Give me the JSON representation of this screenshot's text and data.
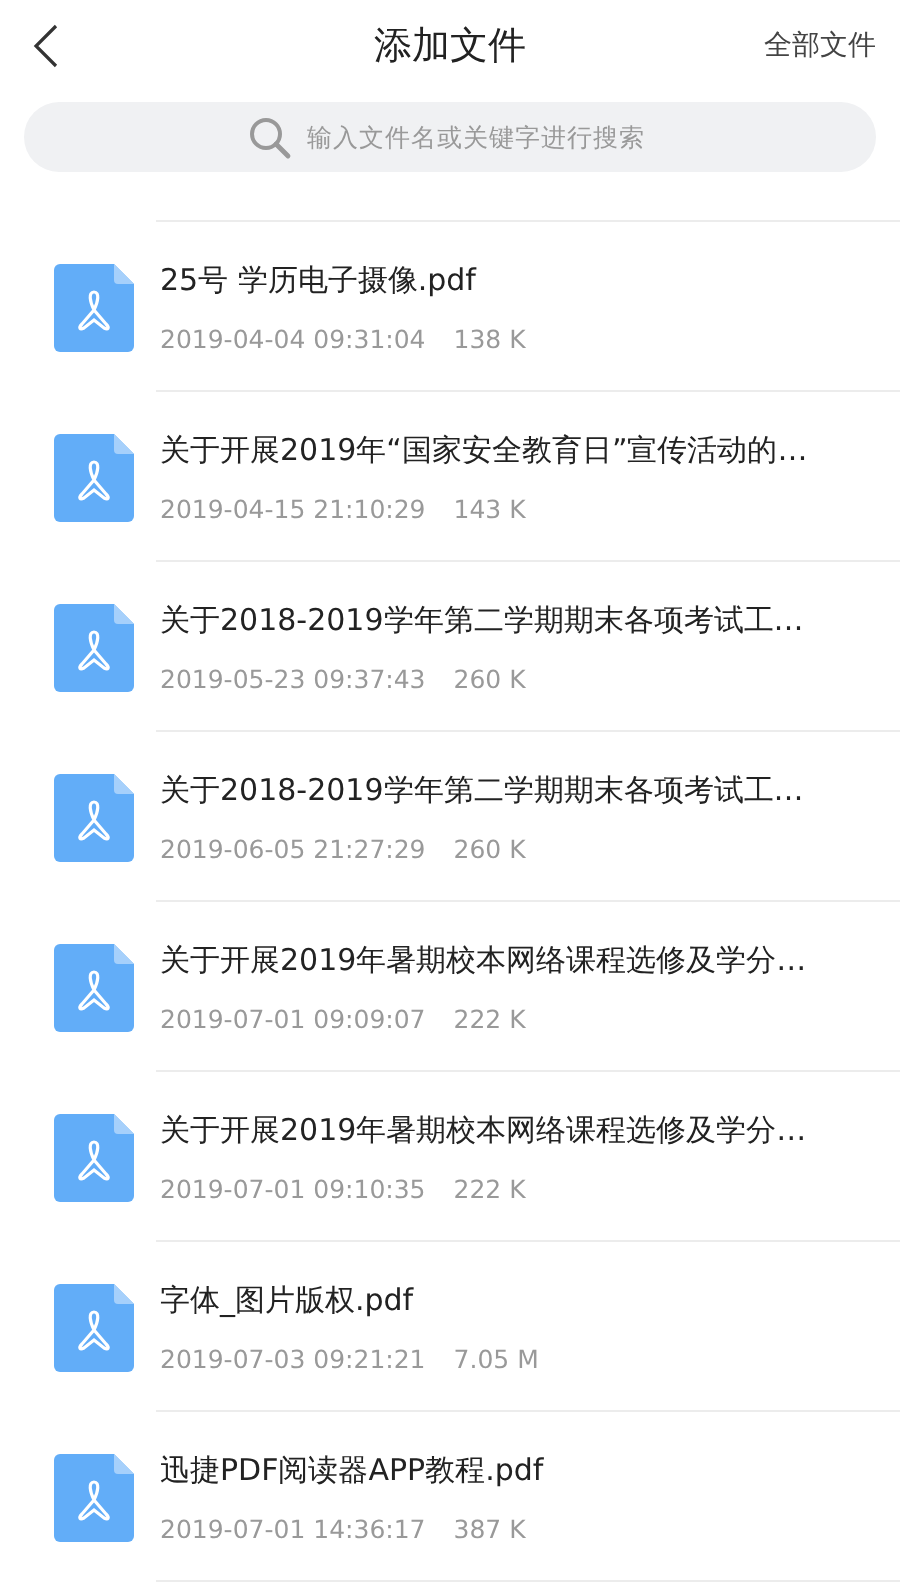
{
  "header": {
    "title": "添加文件",
    "action": "全部文件"
  },
  "search": {
    "placeholder": "输入文件名或关键字进行搜索"
  },
  "files": [
    {
      "name": "25号 学历电子摄像.pdf",
      "date": "2019-04-04 09:31:04",
      "size": "138 K"
    },
    {
      "name": "关于开展2019年“国家安全教育日”宣传活动的…",
      "date": "2019-04-15 21:10:29",
      "size": "143 K"
    },
    {
      "name": "关于2018-2019学年第二学期期末各项考试工…",
      "date": "2019-05-23 09:37:43",
      "size": "260 K"
    },
    {
      "name": "关于2018-2019学年第二学期期末各项考试工…",
      "date": "2019-06-05 21:27:29",
      "size": "260 K"
    },
    {
      "name": "关于开展2019年暑期校本网络课程选修及学分…",
      "date": "2019-07-01 09:09:07",
      "size": "222 K"
    },
    {
      "name": "关于开展2019年暑期校本网络课程选修及学分…",
      "date": "2019-07-01 09:10:35",
      "size": "222 K"
    },
    {
      "name": "字体_图片版权.pdf",
      "date": "2019-07-03 09:21:21",
      "size": "7.05 M"
    },
    {
      "name": "迅捷PDF阅读器APP教程.pdf",
      "date": "2019-07-01 14:36:17",
      "size": "387 K"
    }
  ]
}
